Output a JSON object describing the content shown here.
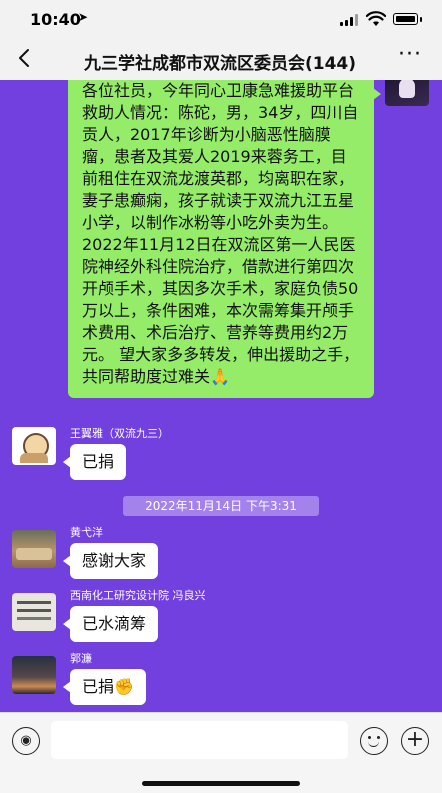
{
  "status_bar": {
    "time": "10:40"
  },
  "nav": {
    "back_icon": "chevron-left-icon",
    "title": "九三学社成都市双流区委员会(144)",
    "more_icon": "more-icon"
  },
  "messages": [
    {
      "from": "self",
      "text": "各位社员，今年同心卫康急难援助平台救助人情况：陈砣，男，34岁，四川自贡人，2017年诊断为小脑恶性脑膜瘤，患者及其爱人2019来蓉务工，目前租住在双流龙渡英郡，均离职在家，妻子患癫痫，孩子就读于双流九江五星小学，以制作冰粉等小吃外卖为生。2022年11月12日在双流区第一人民医院神经外科住院治疗，借款进行第四次开颅手术，其因多次手术，家庭负债50万以上，条件困难，本次需筹集开颅手术费用、术后治疗、营养等费用约2万元。 望大家多多转发，伸出援助之手，共同帮助度过难关🙏"
    },
    {
      "from": "other",
      "sender": "王翼雅（双流九三）",
      "text": "已捐"
    },
    {
      "from": "other",
      "sender": "黄弋洋",
      "text": "感谢大家"
    },
    {
      "from": "other",
      "sender": "西南化工研究设计院  冯良兴",
      "text": "已水滴筹"
    },
    {
      "from": "other",
      "sender": "郭濂",
      "text": "已捐✊"
    }
  ],
  "timestamp": "2022年11月14日 下午3:31",
  "input_bar": {
    "voice_icon": "voice-icon",
    "placeholder": "",
    "emoji_icon": "emoji-icon",
    "plus_icon": "plus-icon"
  },
  "colors": {
    "chat_background": "#7340e0",
    "outgoing_bubble": "#95ec69",
    "incoming_bubble": "#ffffff",
    "bar_background": "#f2f2f2"
  }
}
